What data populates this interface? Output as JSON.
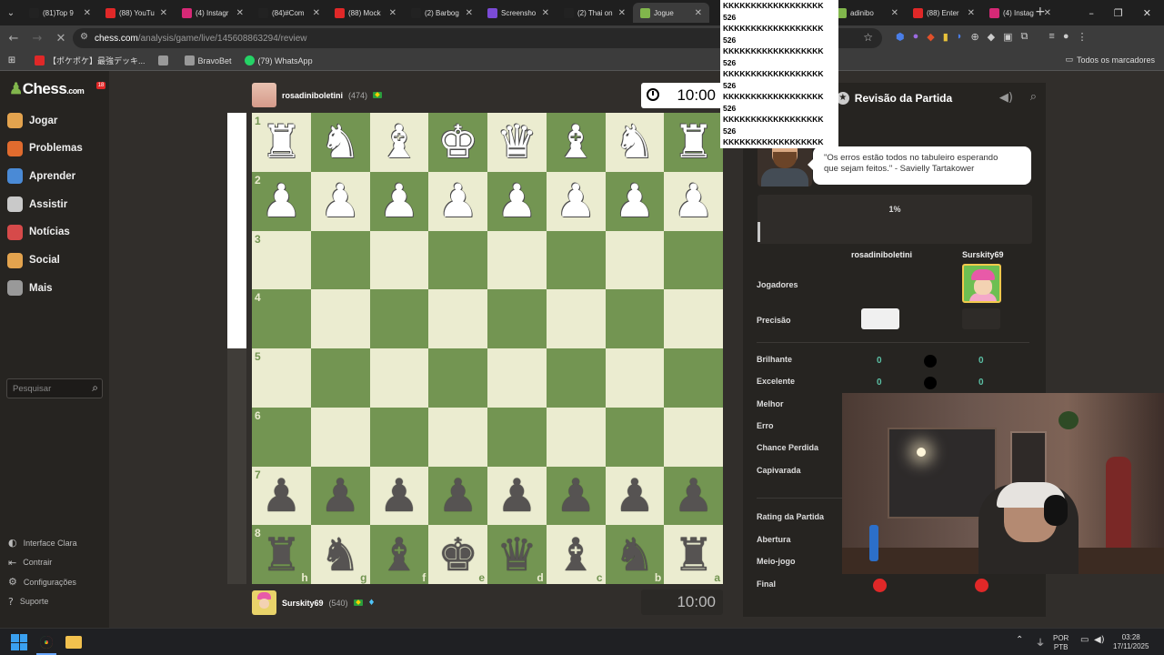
{
  "browser": {
    "tabs": [
      {
        "label": "(81)Top 9",
        "icon_color": "#222",
        "icon": "tiktok-icon"
      },
      {
        "label": "(88) YouTu",
        "icon_color": "#e02828",
        "icon": "youtube-icon"
      },
      {
        "label": "(4) Instagr",
        "icon_color": "#d62976",
        "icon": "instagram-icon"
      },
      {
        "label": "(84)#Com",
        "icon_color": "#222",
        "icon": "tiktok-icon"
      },
      {
        "label": "(88) Mock",
        "icon_color": "#e02828",
        "icon": "youtube-icon"
      },
      {
        "label": "(2) Barbog",
        "icon_color": "#222",
        "icon": "x-icon"
      },
      {
        "label": "Screensho",
        "icon_color": "#7b4bd6",
        "icon": "pen-icon"
      },
      {
        "label": "(2) Thai on",
        "icon_color": "#222",
        "icon": "x-icon"
      },
      {
        "label": "Jogue",
        "icon_color": "#81b64c",
        "icon": "chess-pawn-icon"
      },
      {
        "label": "adinibo",
        "icon_color": "#81b64c",
        "icon": "chess-pawn-icon"
      },
      {
        "label": "(88) Enter",
        "icon_color": "#e02828",
        "icon": "youtube-icon"
      },
      {
        "label": "(4) Instag",
        "icon_color": "#d62976",
        "icon": "instagram-icon"
      }
    ],
    "url_host": "chess.com",
    "url_path": "/analysis/game/live/145608863294/review",
    "bookmarks": [
      {
        "label": "【ポケポケ】最強デッキ...",
        "icon": "youtube-icon"
      },
      {
        "label": "",
        "icon": "globe-icon"
      },
      {
        "label": "BravoBet",
        "icon": "bravobet-icon"
      },
      {
        "label": "(79) WhatsApp",
        "icon": "whatsapp-icon"
      }
    ],
    "all_bookmarks": "Todos os marcadores",
    "overlay_lines": [
      "KKKKKKKKKKKKKKKKKK 526",
      "KKKKKKKKKKKKKKKKKK 526",
      "KKKKKKKKKKKKKKKKKK 526",
      "KKKKKKKKKKKKKKKKKK 526",
      "KKKKKKKKKKKKKKKKKK 526",
      "KKKKKKKKKKKKKKKKKK 526",
      "KKKKKKKKKKKKKKKKKK"
    ]
  },
  "sidebar": {
    "logo": "Chess",
    "logo_suffix": ".com",
    "badge": "18",
    "items": [
      {
        "label": "Jogar",
        "color": "#e3a34e"
      },
      {
        "label": "Problemas",
        "color": "#e06b2e"
      },
      {
        "label": "Aprender",
        "color": "#4a8ad6"
      },
      {
        "label": "Assistir",
        "color": "#c9c9c9"
      },
      {
        "label": "Notícias",
        "color": "#d64a4a"
      },
      {
        "label": "Social",
        "color": "#e3a34e"
      },
      {
        "label": "Mais",
        "color": "#999999"
      }
    ],
    "search_placeholder": "Pesquisar",
    "bottom": [
      "Interface Clara",
      "Contrair",
      "Configurações",
      "Suporte"
    ]
  },
  "game": {
    "top_player": {
      "name": "rosadiniboletini",
      "rating": "(474)"
    },
    "bottom_player": {
      "name": "Surskity69",
      "rating": "(540)"
    },
    "top_clock": "10:00",
    "bottom_clock": "10:00",
    "eval_white_fraction": 0.5,
    "board": [
      [
        "R",
        "N",
        "B",
        "K",
        "Q",
        "B",
        "N",
        "R"
      ],
      [
        "P",
        "P",
        "P",
        "P",
        "P",
        "P",
        "P",
        "P"
      ],
      [
        "",
        "",
        "",
        "",
        "",
        "",
        "",
        ""
      ],
      [
        "",
        "",
        "",
        "",
        "",
        "",
        "",
        ""
      ],
      [
        "",
        "",
        "",
        "",
        "",
        "",
        "",
        ""
      ],
      [
        "",
        "",
        "",
        "",
        "",
        "",
        "",
        ""
      ],
      [
        "p",
        "p",
        "p",
        "p",
        "p",
        "p",
        "p",
        "p"
      ],
      [
        "r",
        "n",
        "b",
        "k",
        "q",
        "b",
        "n",
        "r"
      ]
    ],
    "ranks": [
      "1",
      "2",
      "3",
      "4",
      "5",
      "6",
      "7",
      "8"
    ],
    "files": [
      "h",
      "g",
      "f",
      "e",
      "d",
      "c",
      "b",
      "a"
    ]
  },
  "review": {
    "title": "Revisão da Partida",
    "quote_lines": [
      "\"Os erros estão todos no tabuleiro esperando",
      "que sejam feitos.\" - Savielly Tartakower"
    ],
    "progress_label": "1%",
    "progress_fraction": 0.01,
    "player1": "rosadiniboletini",
    "player2": "Surskity69",
    "rows_top": [
      "Jogadores",
      "Precisão"
    ],
    "categories": [
      {
        "label": "Brilhante",
        "v1": "0",
        "v2": "0"
      },
      {
        "label": "Excelente",
        "v1": "0",
        "v2": "0"
      },
      {
        "label": "Melhor",
        "v1": "",
        "v2": ""
      },
      {
        "label": "Erro",
        "v1": "",
        "v2": ""
      },
      {
        "label": "Chance Perdida",
        "v1": "",
        "v2": ""
      },
      {
        "label": "Capivarada",
        "v1": "",
        "v2": ""
      }
    ],
    "phases": [
      "Rating da Partida",
      "Abertura",
      "Meio-jogo",
      "Final"
    ]
  },
  "taskbar": {
    "lang1": "POR",
    "lang2": "PTB",
    "time": "03:28",
    "date": "17/11/2025"
  }
}
